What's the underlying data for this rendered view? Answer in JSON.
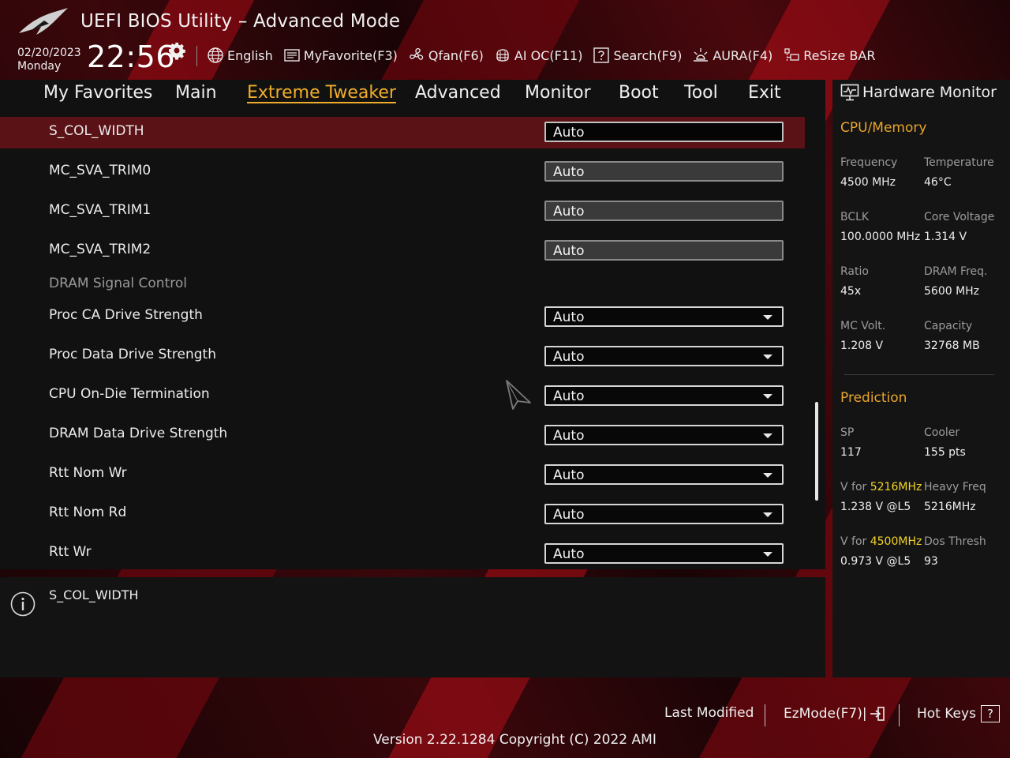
{
  "header": {
    "title": "UEFI BIOS Utility – Advanced Mode",
    "date": "02/20/2023",
    "day": "Monday",
    "time": "22:56",
    "tools": [
      {
        "label": "English",
        "icon": "globe-icon"
      },
      {
        "label": "MyFavorite(F3)",
        "icon": "favorite-list-icon"
      },
      {
        "label": "Qfan(F6)",
        "icon": "fan-icon"
      },
      {
        "label": "AI OC(F11)",
        "icon": "ai-chip-icon"
      },
      {
        "label": "Search(F9)",
        "icon": "search-help-icon"
      },
      {
        "label": "AURA(F4)",
        "icon": "aura-light-icon"
      },
      {
        "label": "ReSize BAR",
        "icon": "resize-bar-icon"
      }
    ]
  },
  "nav": {
    "tabs": [
      {
        "label": "My Favorites"
      },
      {
        "label": "Main"
      },
      {
        "label": "Extreme Tweaker",
        "active": true
      },
      {
        "label": "Advanced"
      },
      {
        "label": "Monitor"
      },
      {
        "label": "Boot"
      },
      {
        "label": "Tool"
      },
      {
        "label": "Exit"
      }
    ]
  },
  "settings": [
    {
      "label": "S_COL_WIDTH",
      "value": "Auto",
      "kind": "text",
      "selected": true
    },
    {
      "label": "MC_SVA_TRIM0",
      "value": "Auto",
      "kind": "text"
    },
    {
      "label": "MC_SVA_TRIM1",
      "value": "Auto",
      "kind": "text"
    },
    {
      "label": "MC_SVA_TRIM2",
      "value": "Auto",
      "kind": "text"
    },
    {
      "label": "DRAM Signal Control",
      "kind": "section"
    },
    {
      "label": "Proc CA Drive Strength",
      "value": "Auto",
      "kind": "select"
    },
    {
      "label": "Proc Data Drive Strength",
      "value": "Auto",
      "kind": "select"
    },
    {
      "label": "CPU On-Die Termination",
      "value": "Auto",
      "kind": "select"
    },
    {
      "label": "DRAM Data Drive Strength",
      "value": "Auto",
      "kind": "select"
    },
    {
      "label": "Rtt Nom Wr",
      "value": "Auto",
      "kind": "select"
    },
    {
      "label": "Rtt Nom Rd",
      "value": "Auto",
      "kind": "select"
    },
    {
      "label": "Rtt Wr",
      "value": "Auto",
      "kind": "select"
    }
  ],
  "help": {
    "text": "S_COL_WIDTH"
  },
  "hw_monitor": {
    "title": "Hardware Monitor",
    "cpu_memory_title": "CPU/Memory",
    "cpu_memory": [
      {
        "l1": "Frequency",
        "v1": "4500 MHz",
        "l2": "Temperature",
        "v2": "46°C"
      },
      {
        "l1": "BCLK",
        "v1": "100.0000 MHz",
        "l2": "Core Voltage",
        "v2": "1.314 V"
      },
      {
        "l1": "Ratio",
        "v1": "45x",
        "l2": "DRAM Freq.",
        "v2": "5600 MHz"
      },
      {
        "l1": "MC Volt.",
        "v1": "1.208 V",
        "l2": "Capacity",
        "v2": "32768 MB"
      }
    ],
    "prediction_title": "Prediction",
    "prediction": {
      "sp_label": "SP",
      "sp_value": "117",
      "cooler_label": "Cooler",
      "cooler_value": "155 pts",
      "v_for": "V for",
      "freq1": "5216MHz",
      "v1": "1.238 V @L5",
      "heavy_label": "Heavy Freq",
      "heavy_value": "5216MHz",
      "freq2": "4500MHz",
      "v2": "0.973 V @L5",
      "dos_label": "Dos Thresh",
      "dos_value": "93"
    }
  },
  "footer": {
    "last_modified": "Last Modified",
    "ezmode": "EzMode(F7)|",
    "hotkeys": "Hot Keys",
    "hotkeys_key": "?",
    "version": "Version 2.22.1284 Copyright (C) 2022 AMI"
  },
  "colors": {
    "accent": "#f0ad2c",
    "selected_row": "#5a1216",
    "highlight_freq": "#f2d42a"
  }
}
